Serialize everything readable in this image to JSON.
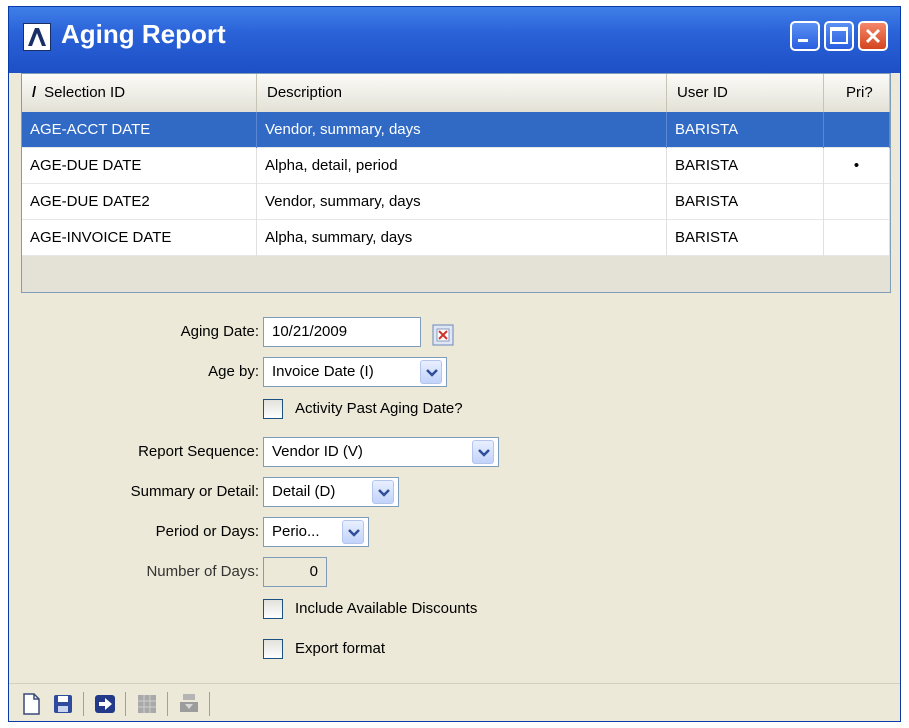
{
  "window": {
    "title": "Aging Report",
    "logo_icon": "abstract-a-logo",
    "controls": [
      "minimize-icon",
      "maximize-icon",
      "close-icon"
    ]
  },
  "grid": {
    "headers": {
      "sort_marker": "/",
      "selection_id": "Selection ID",
      "description": "Description",
      "user_id": "User ID",
      "pri": "Pri?"
    },
    "rows": [
      {
        "selection_id": "AGE-ACCT DATE",
        "description": "Vendor, summary, days",
        "user_id": "BARISTA",
        "pri": ""
      },
      {
        "selection_id": "AGE-DUE DATE",
        "description": "Alpha, detail, period",
        "user_id": "BARISTA",
        "pri": "•"
      },
      {
        "selection_id": "AGE-DUE DATE2",
        "description": "Vendor, summary, days",
        "user_id": "BARISTA",
        "pri": ""
      },
      {
        "selection_id": "AGE-INVOICE DATE",
        "description": "Alpha, summary, days",
        "user_id": "BARISTA",
        "pri": ""
      }
    ],
    "selected_row": 0,
    "selection_color": "#316ac5"
  },
  "form": {
    "aging_date": {
      "label": "Aging Date:",
      "value": "10/21/2009",
      "icon": "calendar-icon"
    },
    "age_by": {
      "label": "Age by:",
      "value": "Invoice Date (I)"
    },
    "activity_past": {
      "label": "Activity Past Aging Date?",
      "checked": false
    },
    "report_sequence": {
      "label": "Report Sequence:",
      "value": "Vendor ID (V)"
    },
    "summary_or_detail": {
      "label": "Summary or Detail:",
      "value": "Detail (D)"
    },
    "period_or_days": {
      "label": "Period or Days:",
      "value": "Perio..."
    },
    "number_of_days": {
      "label": "Number of Days:",
      "value": "0"
    },
    "include_discounts": {
      "label": "Include Available Discounts",
      "checked": false
    },
    "export_format": {
      "label": "Export format",
      "checked": false
    }
  },
  "toolbar": {
    "icons": [
      "new-document-icon",
      "save-icon",
      "run-arrow-icon",
      "grid-disabled-icon",
      "print-disabled-icon"
    ]
  }
}
